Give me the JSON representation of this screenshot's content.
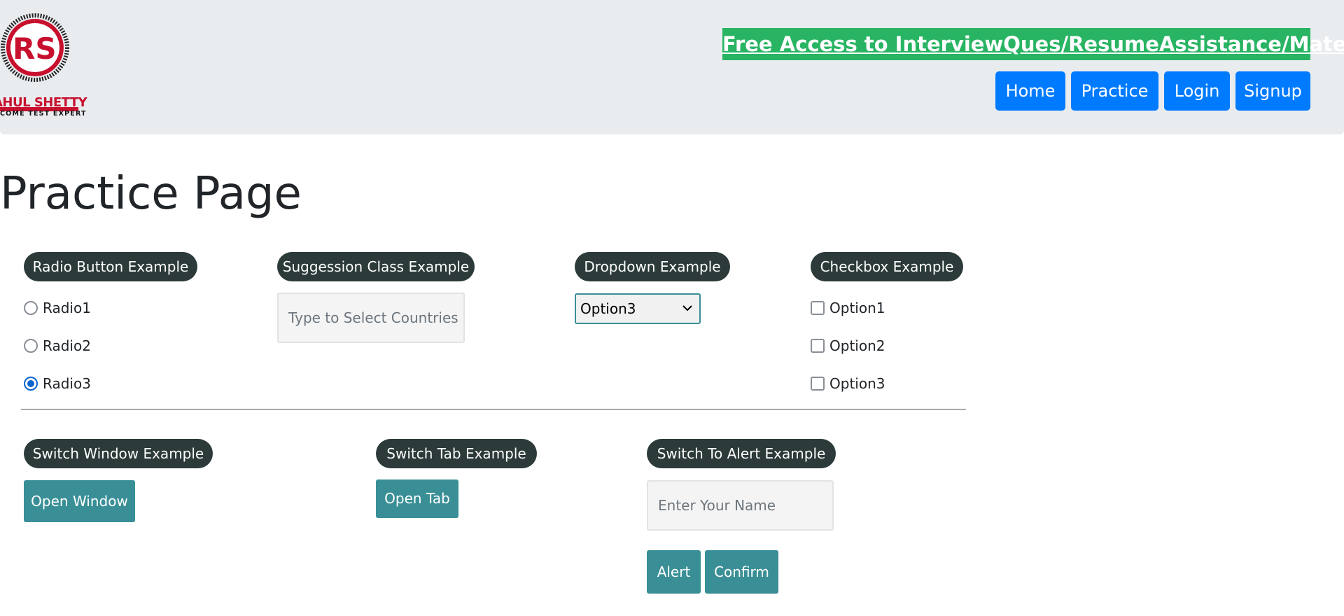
{
  "header": {
    "logo_name": "AHUL SHETTY",
    "logo_tagline": "COME TEST EXPERT",
    "promo_link": "Free Access to InterviewQues/ResumeAssistance/Material",
    "nav": [
      "Home",
      "Practice",
      "Login",
      "Signup"
    ]
  },
  "page_title": "Practice Page",
  "radio_section": {
    "legend": "Radio Button Example",
    "options": [
      "Radio1",
      "Radio2",
      "Radio3"
    ],
    "selected": "Radio3"
  },
  "suggestion_section": {
    "legend": "Suggession Class Example",
    "placeholder": "Type to Select Countries"
  },
  "dropdown_section": {
    "legend": "Dropdown Example",
    "selected": "Option3"
  },
  "checkbox_section": {
    "legend": "Checkbox Example",
    "options": [
      "Option1",
      "Option2",
      "Option3"
    ]
  },
  "switch_window": {
    "legend": "Switch Window Example",
    "button": "Open Window"
  },
  "switch_tab": {
    "legend": "Switch Tab Example",
    "button": "Open Tab"
  },
  "alert_section": {
    "legend": "Switch To Alert Example",
    "placeholder": "Enter Your Name",
    "alert_button": "Alert",
    "confirm_button": "Confirm"
  },
  "colors": {
    "header_bg": "#e9ecef",
    "promo_bg": "#28b463",
    "nav_bg": "#007bff",
    "pill_bg": "#2c3a3a",
    "teal_button": "#3a8f96"
  }
}
